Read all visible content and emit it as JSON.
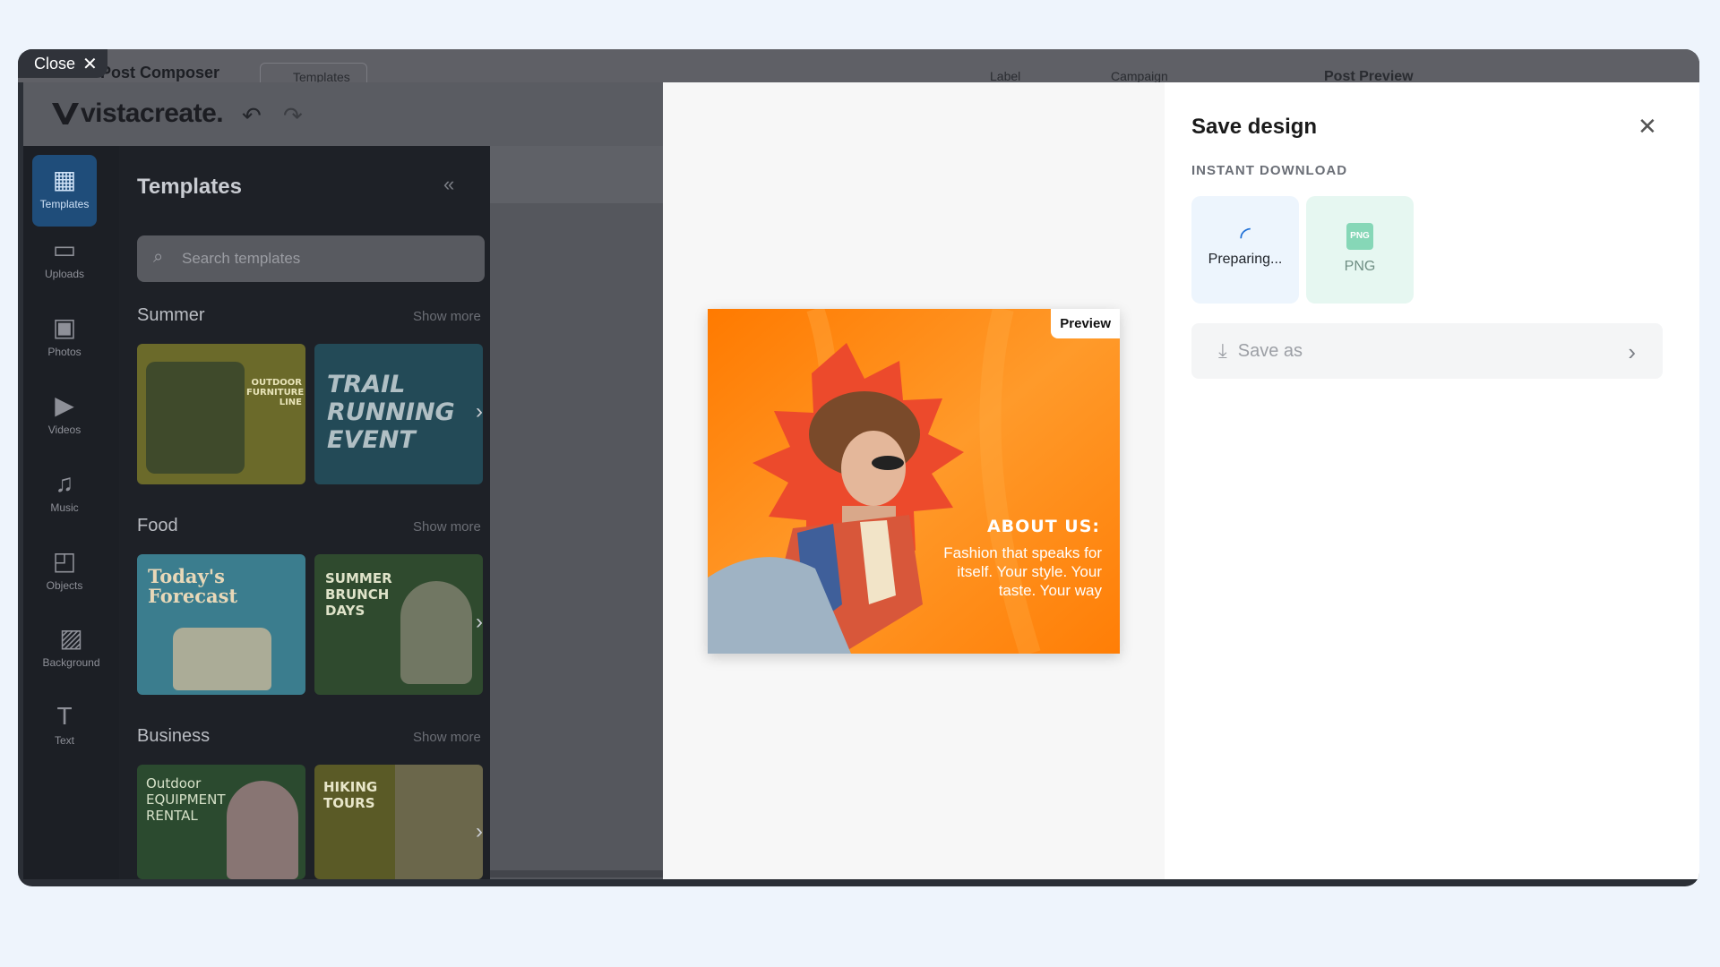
{
  "background_page": {
    "close_label": "Close",
    "title": "Post Composer",
    "templates_tab": "Templates",
    "label_menu": "Label",
    "campaign_menu": "Campaign",
    "post_preview": "Post Preview"
  },
  "editor": {
    "logo": "vistacreate.",
    "sidebar": [
      {
        "label": "Templates",
        "icon": "grid-icon"
      },
      {
        "label": "Uploads",
        "icon": "folder-icon"
      },
      {
        "label": "Photos",
        "icon": "image-icon"
      },
      {
        "label": "Videos",
        "icon": "video-icon"
      },
      {
        "label": "Music",
        "icon": "music-icon"
      },
      {
        "label": "Objects",
        "icon": "shapes-icon"
      },
      {
        "label": "Background",
        "icon": "pattern-icon"
      },
      {
        "label": "Text",
        "icon": "text-icon"
      }
    ],
    "panel": {
      "title": "Templates",
      "search_placeholder": "Search templates",
      "show_more": "Show more",
      "sections": [
        {
          "title": "Summer",
          "thumbs": [
            "OUTDOOR FURNITURE LINE",
            "TRAIL RUNNING EVENT"
          ]
        },
        {
          "title": "Food",
          "thumbs": [
            "Today's Forecast",
            "SUMMER BRUNCH DAYS"
          ]
        },
        {
          "title": "Business",
          "thumbs": [
            "Outdoor EQUIPMENT RENTAL",
            "HIKING TOURS"
          ]
        }
      ]
    }
  },
  "modal": {
    "preview_badge": "Preview",
    "design": {
      "headline": "ABOUT US:",
      "tagline": "Fashion that speaks for itself. Your style. Your taste. Your way"
    },
    "save_panel": {
      "title": "Save design",
      "subtitle": "INSTANT DOWNLOAD",
      "preparing_label": "Preparing...",
      "png_label": "PNG",
      "png_icon_text": "PNG",
      "save_as_label": "Save as"
    }
  },
  "colors": {
    "accent": "#1d6fd6",
    "design_orange": "#ff8a10",
    "design_red": "#ec4a2c"
  }
}
